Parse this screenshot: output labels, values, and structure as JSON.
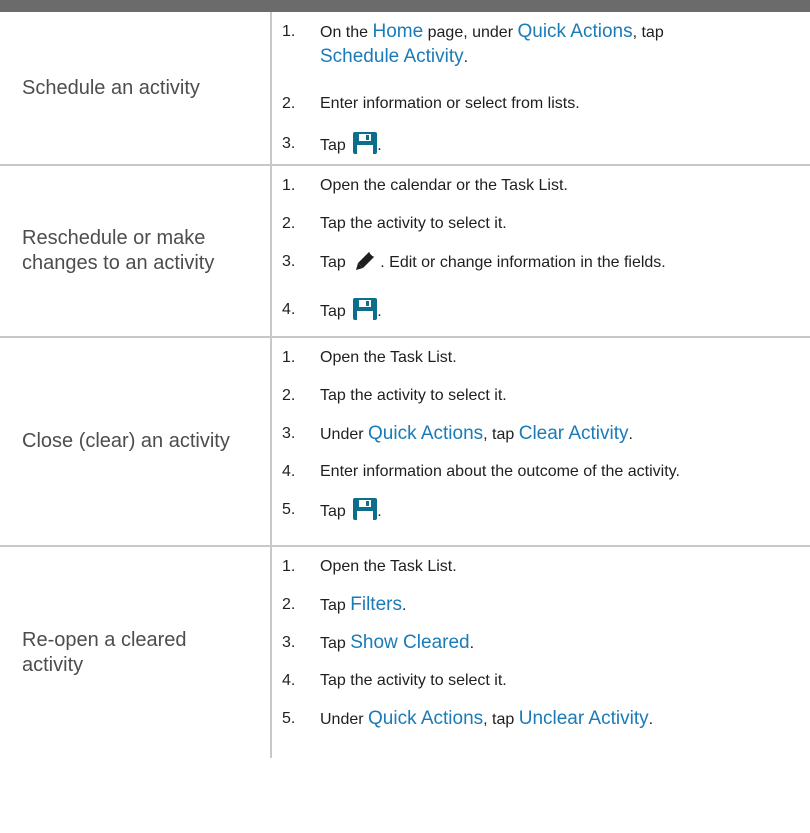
{
  "rows": [
    {
      "task": "Schedule an activity",
      "steps": [
        {
          "num": "1.",
          "t1": "On the ",
          "l1": "Home",
          "t2": " page, under ",
          "l2": "Quick Actions",
          "t3": ", tap",
          "l3": "Schedule Activity",
          "t4": "."
        },
        {
          "num": "2.",
          "t1": "Enter information or select from lists."
        },
        {
          "num": "3.",
          "t1": "Tap ",
          "icon": "save-icon",
          "t2": "."
        }
      ]
    },
    {
      "task": "Reschedule or make changes to an activity",
      "steps": [
        {
          "num": "1.",
          "t1": "Open the calendar or the Task List."
        },
        {
          "num": "2.",
          "t1": "Tap the activity to select it."
        },
        {
          "num": "3.",
          "t1": "Tap ",
          "icon": "pencil-icon",
          "t2": ". Edit or change information in the fields."
        },
        {
          "num": "4.",
          "t1": "Tap ",
          "icon": "save-icon",
          "t2": "."
        }
      ]
    },
    {
      "task": "Close (clear) an activity",
      "steps": [
        {
          "num": "1.",
          "t1": "Open the Task List."
        },
        {
          "num": "2.",
          "t1": "Tap the activity to select it."
        },
        {
          "num": "3.",
          "t1": "Under ",
          "l1": "Quick Actions",
          "t2": ", tap ",
          "l2": "Clear Activity",
          "t3": "."
        },
        {
          "num": "4.",
          "t1": "Enter information about the outcome of the activity."
        },
        {
          "num": "5.",
          "t1": "Tap ",
          "icon": "save-icon",
          "t2": "."
        }
      ]
    },
    {
      "task": "Re-open a cleared activity",
      "steps": [
        {
          "num": "1.",
          "t1": "Open the Task List."
        },
        {
          "num": "2.",
          "t1": "Tap ",
          "l1": "Filters",
          "t2": "."
        },
        {
          "num": "3.",
          "t1": "Tap ",
          "l1": "Show Cleared",
          "t2": "."
        },
        {
          "num": "4.",
          "t1": "Tap the activity to select it."
        },
        {
          "num": "5.",
          "t1": "Under ",
          "l1": "Quick Actions",
          "t2": ", tap ",
          "l2": "Unclear Activity",
          "t3": "."
        }
      ]
    }
  ],
  "colors": {
    "link": "#1a7bb8",
    "icon": "#0b6f8c",
    "border": "#c8c8c8",
    "topbar": "#6b6b6b"
  }
}
